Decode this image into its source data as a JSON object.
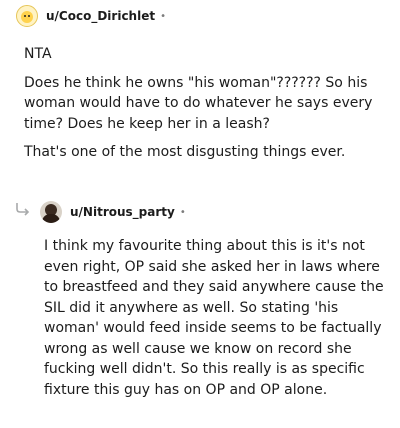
{
  "comments": [
    {
      "username": "u/Coco_Dirichlet",
      "avatar_icon": "cheese-mascot-avatar-icon",
      "paragraphs": [
        "NTA",
        "Does he think he owns \"his woman\"?????? So his woman would have to do whatever he says every time? Does he keep her in a leash?",
        "That's one of the most disgusting things ever."
      ]
    },
    {
      "username": "u/Nitrous_party",
      "avatar_icon": "person-avatar-icon",
      "paragraphs": [
        "I think my favourite thing about this is it's not even right, OP said she asked her in laws where to breastfeed and they said anywhere cause the SIL did it anywhere as well. So stating 'his woman' would feed inside seems to be factually wrong as well cause we know on record she fucking well didn't. So this really is as specific fixture this guy has on OP and OP alone."
      ]
    }
  ],
  "separator": "•",
  "colors": {
    "text": "#1c1c1c",
    "meta": "#7c7c7c",
    "thread_line": "#edeff1"
  }
}
